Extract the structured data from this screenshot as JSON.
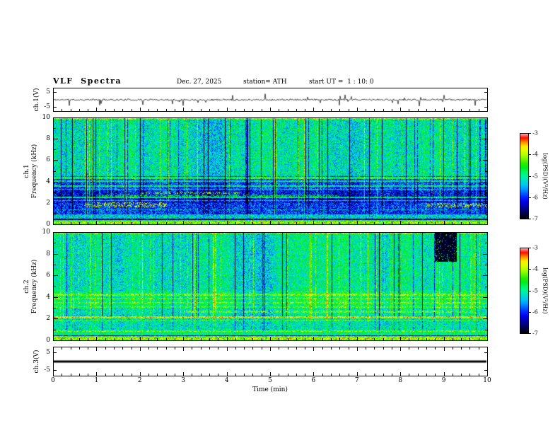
{
  "header": {
    "title": "VLF  Spectra",
    "date": "Dec. 27, 2025",
    "station": "station= ATH",
    "start_ut": "start UT =  1 : 10: 0"
  },
  "axes": {
    "time_label": "Time  (min)",
    "time_ticks": [
      "0",
      "1",
      "2",
      "3",
      "4",
      "5",
      "6",
      "7",
      "8",
      "9",
      "10"
    ],
    "time_range": [
      0,
      10
    ],
    "freq_ticks": [
      "10",
      "8",
      "6",
      "4",
      "2",
      "0"
    ],
    "freq_range": [
      0,
      10
    ],
    "volt_ticks": [
      "5",
      "-5"
    ],
    "volt_range": [
      -8,
      8
    ],
    "ch1v_label": "ch.1(V)",
    "ch3v_label": "ch.3(V)",
    "ch1_channel": "ch.1",
    "ch2_channel": "ch.2",
    "freq_axis_label": "Frequency  (kHz)"
  },
  "colorbar": {
    "label": "log(PSD)(V²/Hz)",
    "ticks": [
      "-3",
      "-4",
      "-5",
      "-6",
      "-7"
    ],
    "range": [
      -7,
      -3
    ],
    "colors_top_to_bottom": [
      "#ffaaaa",
      "#ff0000",
      "#ff7800",
      "#ffff00",
      "#aaff00",
      "#00e600",
      "#00ff8c",
      "#00beff",
      "#0000ff",
      "#000060",
      "#000000"
    ]
  },
  "chart_data": [
    {
      "type": "line",
      "name": "ch1_voltage_waveform",
      "ylabel": "ch.1(V)",
      "xlabel": "Time (min)",
      "xlim": [
        0,
        10
      ],
      "ylim": [
        -8,
        8
      ],
      "yticks": [
        5,
        -5
      ],
      "description": "Broadband VLF receiver output: noise band around 0 V with random impulsive sferic spikes up to about +/-5 V",
      "noise_amplitude_v": 0.6,
      "spike_probability": 0.035,
      "spike_amplitude_v": 4.5,
      "line_width": 0.7
    },
    {
      "type": "heatmap",
      "name": "ch1_spectrogram",
      "ylabel": "ch.1 Frequency (kHz)",
      "xlabel": "Time (min)",
      "xlim": [
        0,
        10
      ],
      "ylim": [
        0,
        10
      ],
      "zlim": [
        -7,
        -3
      ],
      "zlabel": "log(PSD)(V²/Hz)",
      "noise": 1.3,
      "bands": [
        {
          "f": [
            4.5,
            10
          ],
          "v": -5.1
        },
        {
          "f": [
            3.2,
            4.5
          ],
          "v": -5.9
        },
        {
          "f": [
            2.0,
            3.2
          ],
          "v": -6.2
        },
        {
          "f": [
            0.9,
            2.0
          ],
          "v": -6.0
        },
        {
          "f": [
            0.45,
            0.9
          ],
          "v": -5.3
        },
        {
          "f": [
            0,
            0.45
          ],
          "v": -4.6
        }
      ],
      "lines": [
        {
          "f": 10,
          "v": -4.4,
          "w": 0.1
        },
        {
          "f": 4.35,
          "v": -4.7,
          "w": 0.09
        },
        {
          "f": 4.05,
          "v": -5.0,
          "w": 0.06
        },
        {
          "f": 3.6,
          "v": -4.9,
          "w": 0.06
        },
        {
          "f": 3.3,
          "v": -5.2,
          "w": 0.05
        },
        {
          "f": 2.5,
          "v": -4.9,
          "w": 0.07
        },
        {
          "f": 2.2,
          "v": -5.2,
          "w": 0.05
        },
        {
          "f": 1.35,
          "v": -5.5,
          "w": 0.05
        },
        {
          "f": 0.45,
          "v": -6.6,
          "w": 0.05
        },
        {
          "f": 0.15,
          "v": -3.9,
          "w": 0.1
        }
      ],
      "patches": [
        {
          "x": [
            0.7,
            2.6
          ],
          "f": [
            1.55,
            2.05
          ],
          "v": -3.8,
          "density": 0.3
        },
        {
          "x": [
            8.6,
            10
          ],
          "f": [
            1.6,
            2.0
          ],
          "v": -3.9,
          "density": 0.3
        },
        {
          "x": [
            1.0,
            6.6
          ],
          "f": [
            2.6,
            2.8
          ],
          "v": -4.6,
          "density": 0.45
        },
        {
          "x": [
            2.0,
            4.3
          ],
          "f": [
            2.88,
            3.05
          ],
          "v": -4.2,
          "density": 0.4
        }
      ],
      "streaks": {
        "dark_prob": 0.1,
        "bright_prob": 0.07,
        "dark_dv": -1.5,
        "bright_dv": 0.9
      }
    },
    {
      "type": "heatmap",
      "name": "ch2_spectrogram",
      "ylabel": "ch.2 Frequency (kHz)",
      "xlabel": "Time (min)",
      "xlim": [
        0,
        10
      ],
      "ylim": [
        0,
        10
      ],
      "zlim": [
        -7,
        -3
      ],
      "zlabel": "log(PSD)(V²/Hz)",
      "noise": 1.2,
      "bands": [
        {
          "f": [
            4.6,
            10
          ],
          "v": -5.0
        },
        {
          "f": [
            3.0,
            4.6
          ],
          "v": -4.8
        },
        {
          "f": [
            2.35,
            3.0
          ],
          "v": -5.0
        },
        {
          "f": [
            0.9,
            2.35
          ],
          "v": -5.1
        },
        {
          "f": [
            0.35,
            0.9
          ],
          "v": -4.9
        },
        {
          "f": [
            0,
            0.35
          ],
          "v": -4.3
        }
      ],
      "lines": [
        {
          "f": 10,
          "v": -4.4,
          "w": 0.1
        },
        {
          "f": 4.25,
          "v": -4.1,
          "w": 0.09
        },
        {
          "f": 3.85,
          "v": -4.3,
          "w": 0.07
        },
        {
          "f": 3.45,
          "v": -4.3,
          "w": 0.06
        },
        {
          "f": 3.1,
          "v": -4.4,
          "w": 0.06
        },
        {
          "f": 2.15,
          "v": -3.8,
          "w": 0.1
        },
        {
          "f": 1.8,
          "v": -4.6,
          "w": 0.06
        },
        {
          "f": 0.8,
          "v": -4.3,
          "w": 0.07
        },
        {
          "f": 0.4,
          "v": -6.3,
          "w": 0.05
        },
        {
          "f": 0.12,
          "v": -3.9,
          "w": 0.09
        }
      ],
      "patches": [
        {
          "x": [
            8.8,
            9.3
          ],
          "f": [
            7.3,
            10
          ],
          "v": -6.9,
          "density": 0.92
        },
        {
          "x": [
            3.0,
            9.7
          ],
          "f": [
            2.55,
            2.75
          ],
          "v": -4.1,
          "density": 0.5
        }
      ],
      "streaks": {
        "dark_prob": 0.04,
        "bright_prob": 0.12,
        "dark_dv": -1.6,
        "bright_dv": 0.7
      }
    },
    {
      "type": "line",
      "name": "ch3_voltage_waveform",
      "ylabel": "ch.3(V)",
      "xlabel": "Time (min)",
      "xlim": [
        0,
        10
      ],
      "ylim": [
        -8,
        8
      ],
      "yticks": [
        5,
        -5
      ],
      "description": "Flat trace at 0 V (channel inactive)",
      "noise_amplitude_v": 0.03,
      "spike_probability": 0,
      "spike_amplitude_v": 0,
      "line_width": 3
    }
  ]
}
